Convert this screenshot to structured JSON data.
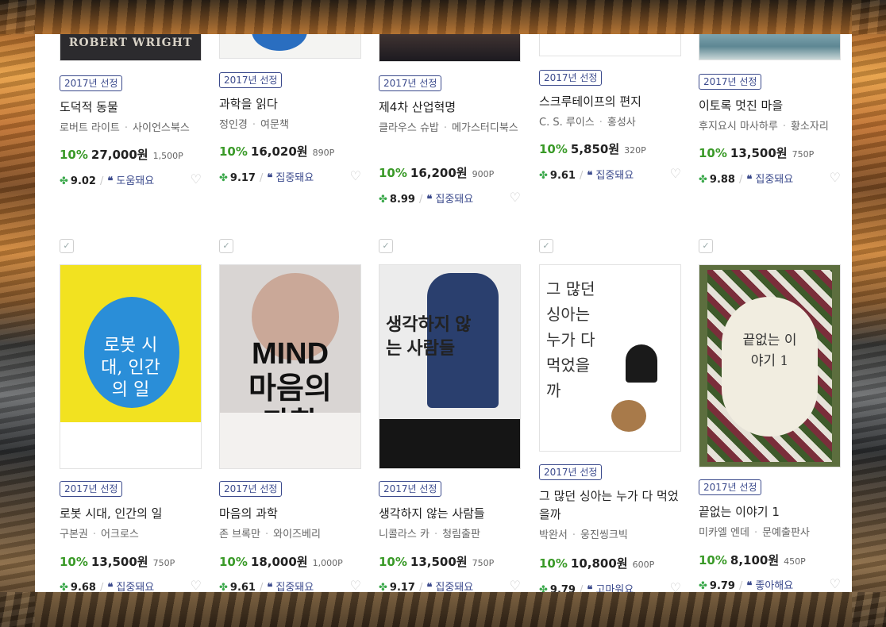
{
  "icons": {
    "clover": "clover-icon",
    "quote": "quote-icon",
    "heart": "heart-icon",
    "check": "check-icon"
  },
  "colors": {
    "discount": "#3a9a28",
    "tag": "#3b4a8c",
    "clover": "#3aa84a"
  },
  "row1": [
    {
      "cover_text": "ROBERT WRIGHT",
      "tag": "2017년 선정",
      "title": "도덕적 동물",
      "author": "로버트 라이트",
      "publisher": "사이언스북스",
      "discount": "10%",
      "price": "27,000원",
      "points": "1,500P",
      "score": "9.02",
      "review": "도움돼요"
    },
    {
      "cover_text": "",
      "tag": "2017년 선정",
      "title": "과학을 읽다",
      "author": "정인경",
      "publisher": "여문책",
      "discount": "10%",
      "price": "16,020원",
      "points": "890P",
      "score": "9.17",
      "review": "집중돼요"
    },
    {
      "cover_text": "",
      "tag": "2017년 선정",
      "title": "제4차 산업혁명",
      "author": "클라우스 슈밥",
      "publisher": "메가스터디북스",
      "discount": "10%",
      "price": "16,200원",
      "points": "900P",
      "score": "8.99",
      "review": "집중돼요"
    },
    {
      "cover_text": "",
      "tag": "2017년 선정",
      "title": "스크루테이프의 편지",
      "author": "C. S. 루이스",
      "publisher": "홍성사",
      "discount": "10%",
      "price": "5,850원",
      "points": "320P",
      "score": "9.61",
      "review": "집중돼요"
    },
    {
      "cover_text": "",
      "tag": "2017년 선정",
      "title": "이토록 멋진 마을",
      "author": "후지요시 마사하루",
      "publisher": "황소자리",
      "discount": "10%",
      "price": "13,500원",
      "points": "750P",
      "score": "9.88",
      "review": "집중돼요"
    }
  ],
  "row2": [
    {
      "cover_text": "로봇 시대, 인간의 일",
      "tag": "2017년 선정",
      "title": "로봇 시대, 인간의 일",
      "author": "구본권",
      "publisher": "어크로스",
      "discount": "10%",
      "price": "13,500원",
      "points": "750P",
      "score": "9.68",
      "review": "집중돼요"
    },
    {
      "cover_text": "MIND 마음의 과학",
      "tag": "2017년 선정",
      "title": "마음의 과학",
      "author": "존 브록만",
      "publisher": "와이즈베리",
      "discount": "10%",
      "price": "18,000원",
      "points": "1,000P",
      "score": "9.61",
      "review": "집중돼요"
    },
    {
      "cover_text": "생각하지 않는 사람들",
      "tag": "2017년 선정",
      "title": "생각하지 않는 사람들",
      "author": "니콜라스 카",
      "publisher": "청림출판",
      "discount": "10%",
      "price": "13,500원",
      "points": "750P",
      "score": "9.17",
      "review": "집중돼요"
    },
    {
      "cover_text": "그 많던 싱아는 누가 다 먹었을까",
      "tag": "2017년 선정",
      "title": "그 많던 싱아는 누가 다 먹었을까",
      "author": "박완서",
      "publisher": "웅진씽크빅",
      "discount": "10%",
      "price": "10,800원",
      "points": "600P",
      "score": "9.79",
      "review": "고마워요"
    },
    {
      "cover_text": "끝없는 이야기 1",
      "tag": "2017년 선정",
      "title": "끝없는 이야기 1",
      "author": "미카엘 엔데",
      "publisher": "문예출판사",
      "discount": "10%",
      "price": "8,100원",
      "points": "450P",
      "score": "9.79",
      "review": "좋아해요"
    }
  ]
}
